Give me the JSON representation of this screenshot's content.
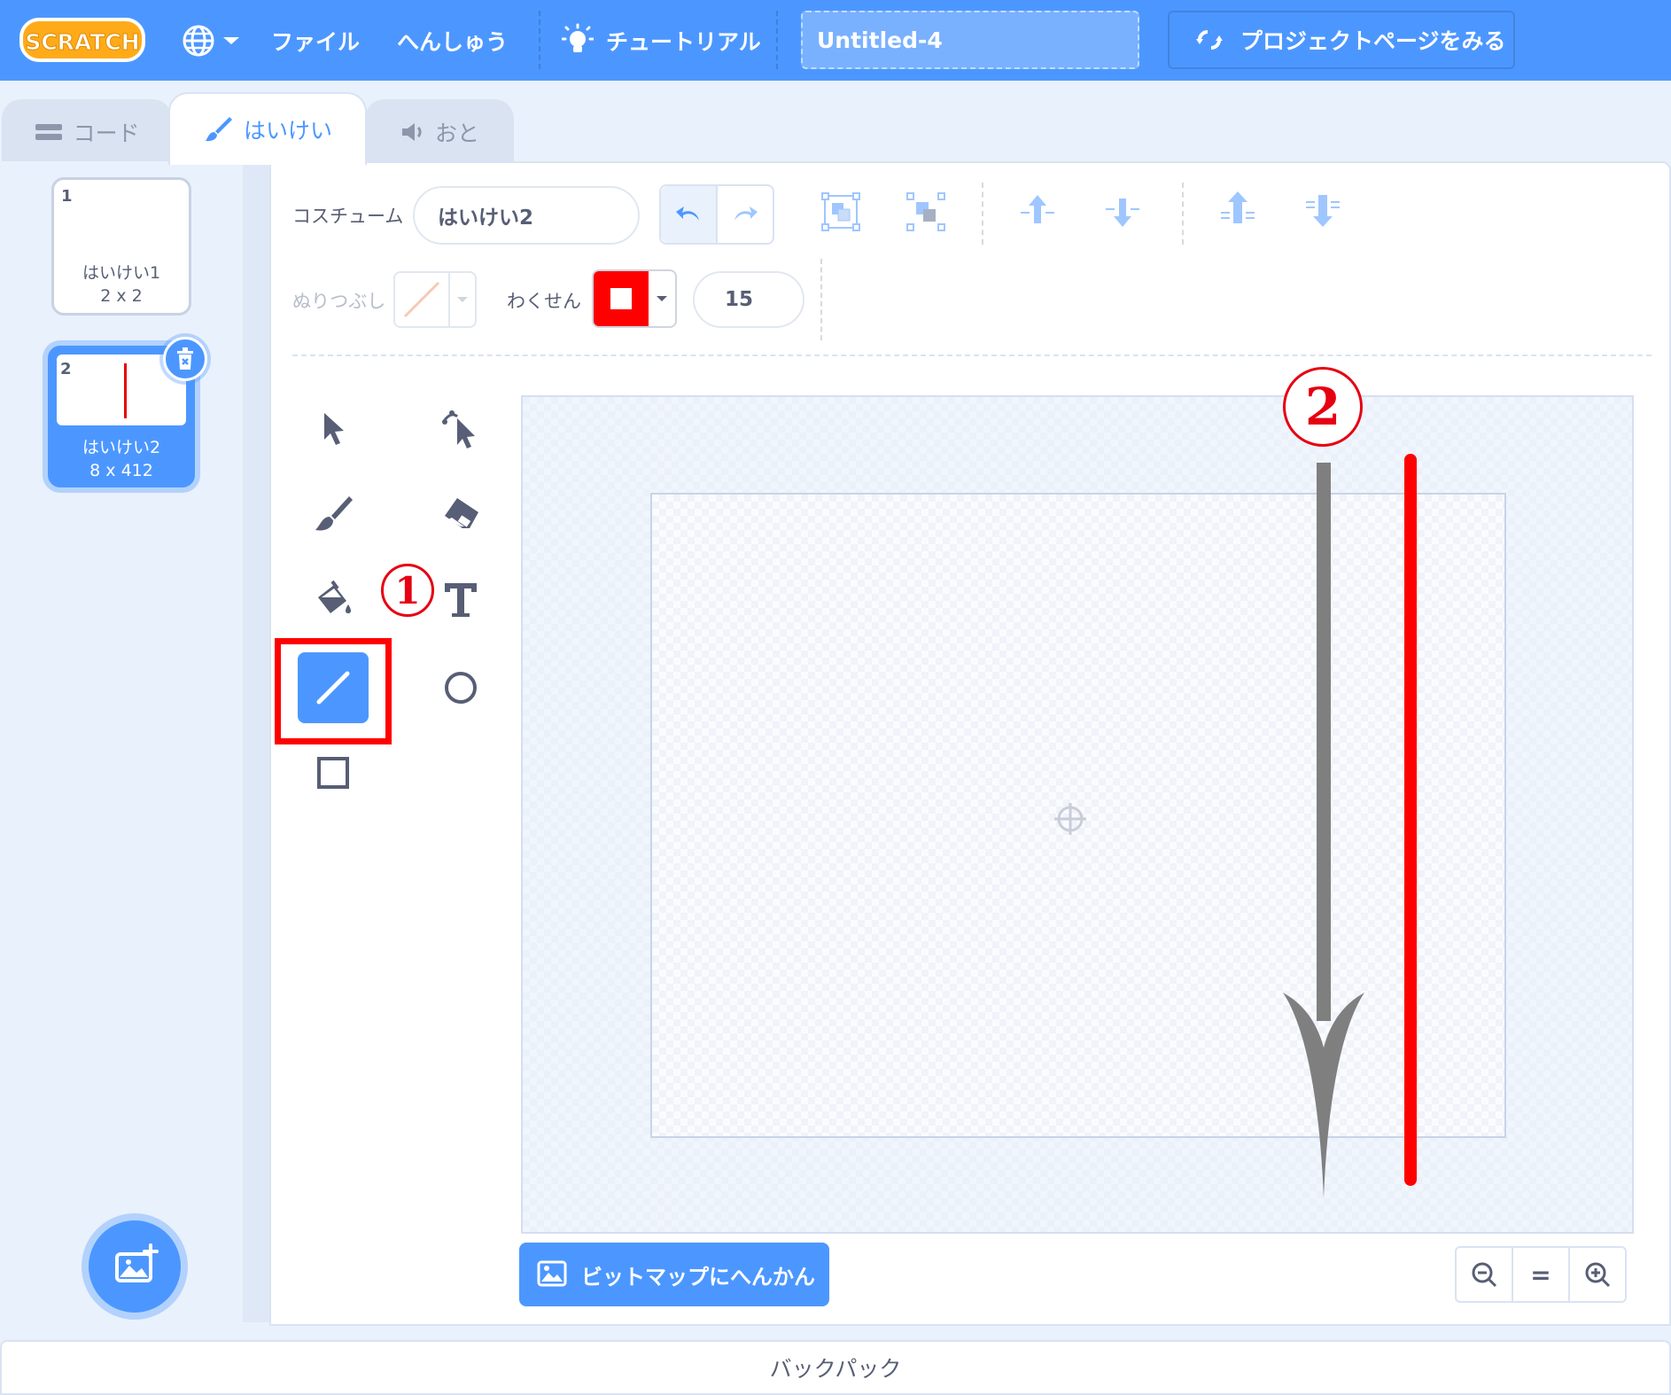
{
  "menubar": {
    "logo_text": "SCRATCH",
    "file": "ファイル",
    "edit": "へんしゅう",
    "tutorials": "チュートリアル",
    "project_title": "Untitled-4",
    "see_project_page": "プロジェクトページをみる"
  },
  "tabs": [
    {
      "label": "コード"
    },
    {
      "label": "はいけい"
    },
    {
      "label": "おと"
    }
  ],
  "costumes": [
    {
      "number": "1",
      "name": "はいけい1",
      "size": "2 x 2"
    },
    {
      "number": "2",
      "name": "はいけい2",
      "size": "8 x 412"
    }
  ],
  "editor": {
    "costume_label": "コスチューム",
    "costume_name": "はいけい2",
    "fill_label": "ぬりつぶし",
    "outline_label": "わくせん",
    "outline_width": "15",
    "outline_color": "#ff0000",
    "convert_button": "ビットマップにへんかん",
    "zoom_reset": "="
  },
  "annotations": {
    "step1": "1",
    "step2": "2",
    "highlight_color": "#ff0000"
  },
  "backpack": "バックパック",
  "colors": {
    "brand": "#4c97ff",
    "menubar": "#4c97ff",
    "text": "#575e75"
  }
}
